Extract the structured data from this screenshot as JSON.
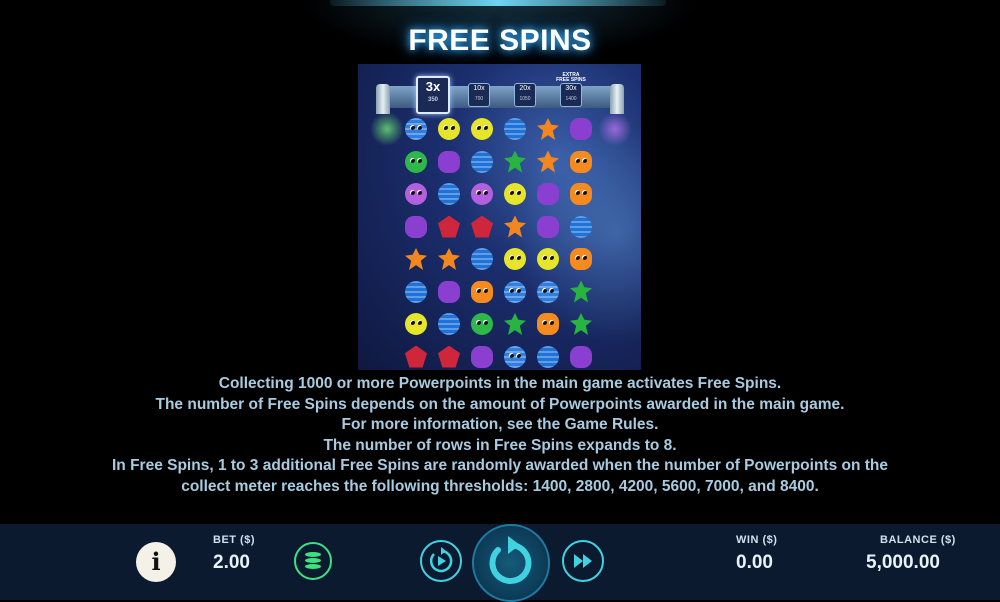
{
  "title": "FREE SPINS",
  "meter": {
    "active": {
      "mult": "3x",
      "points": "350"
    },
    "steps": [
      {
        "mult": "10x",
        "points": "700"
      },
      {
        "mult": "20x",
        "points": "1050"
      },
      {
        "mult": "30x",
        "points": "1400"
      }
    ],
    "extra_label": "EXTRA FREE SPINS"
  },
  "board": {
    "rows": [
      [
        "blue-alien",
        "yellow-alien",
        "yellow-alien",
        "blue-ball",
        "orange-fuzzy",
        "purple-gem"
      ],
      [
        "green-alien",
        "purple-gem",
        "blue-ball",
        "green-flower",
        "orange-fuzzy",
        "orange-egg"
      ],
      [
        "purple-alien",
        "blue-ball",
        "purple-alien",
        "yellow-alien",
        "purple-gem",
        "orange-egg"
      ],
      [
        "purple-gem",
        "red-crystal",
        "red-crystal",
        "orange-fuzzy",
        "purple-gem",
        "blue-ball"
      ],
      [
        "orange-fuzzy",
        "orange-fuzzy",
        "blue-ball",
        "yellow-alien",
        "yellow-alien",
        "orange-egg"
      ],
      [
        "blue-ball",
        "purple-gem",
        "orange-egg",
        "blue-alien",
        "blue-alien",
        "green-flower"
      ],
      [
        "yellow-alien",
        "blue-ball",
        "green-alien",
        "green-flower",
        "orange-egg",
        "green-flower"
      ],
      [
        "red-crystal",
        "red-crystal",
        "purple-gem",
        "blue-alien",
        "blue-ball",
        "purple-gem"
      ]
    ]
  },
  "info_lines": [
    "Collecting 1000 or more Powerpoints in the main game activates Free Spins.",
    "The number of Free Spins depends on the amount of Powerpoints awarded in the main game.",
    "For more information, see the Game Rules.",
    "The number of rows in Free Spins expands to 8.",
    "In Free Spins, 1 to 3 additional Free Spins are randomly awarded when the number of Powerpoints on the",
    "collect meter reaches the following thresholds: 1400, 2800, 4200, 5600, 7000, and 8400."
  ],
  "bottom": {
    "info_icon": "i",
    "bet_label": "BET ($)",
    "bet_value": "2.00",
    "win_label": "WIN ($)",
    "win_value": "0.00",
    "balance_label": "BALANCE ($)",
    "balance_value": "5,000.00"
  },
  "colors": {
    "blue-alien": "#2f7fe0",
    "yellow-alien": "#e7e52a",
    "blue-ball": "#1f73d8",
    "orange-fuzzy": "#f3871f",
    "purple-gem": "#8a3fd0",
    "green-alien": "#2fb84a",
    "green-flower": "#27b440",
    "orange-egg": "#f58a1e",
    "purple-alien": "#b35fe0",
    "red-crystal": "#d0263b",
    "accent": "#40d2e0"
  }
}
